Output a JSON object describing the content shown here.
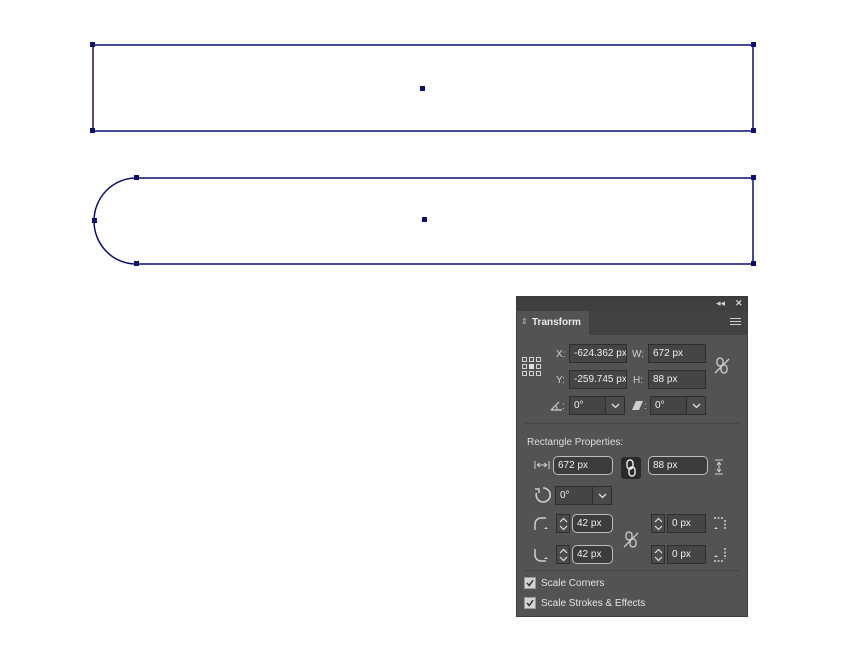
{
  "canvas": {
    "shapes": [
      "rectangle",
      "rounded-left-rectangle"
    ],
    "stroke_color": "#0b0f6e",
    "background": "#ffffff"
  },
  "panel": {
    "collapse_label": "◂◂",
    "close_label": "✕",
    "tab_title": "Transform",
    "x_label": "X:",
    "x_value": "-624.362 px",
    "y_label": "Y:",
    "y_value": "-259.745 px",
    "w_label": "W:",
    "w_value": "672 px",
    "h_label": "H:",
    "h_value": "88 px",
    "angle_label": ":",
    "angle_value": "0°",
    "shear_label": ":",
    "shear_value": "0°",
    "section_title": "Rectangle Properties:",
    "rect_width": "672 px",
    "rect_height": "88 px",
    "rect_rotation": "0°",
    "corner_tl": "42 px",
    "corner_bl": "42 px",
    "corner_tr": "0 px",
    "corner_br": "0 px",
    "scale_corners_label": "Scale Corners",
    "scale_corners_checked": true,
    "scale_strokes_label": "Scale Strokes & Effects",
    "scale_strokes_checked": true,
    "panel_bg": "#535353"
  }
}
